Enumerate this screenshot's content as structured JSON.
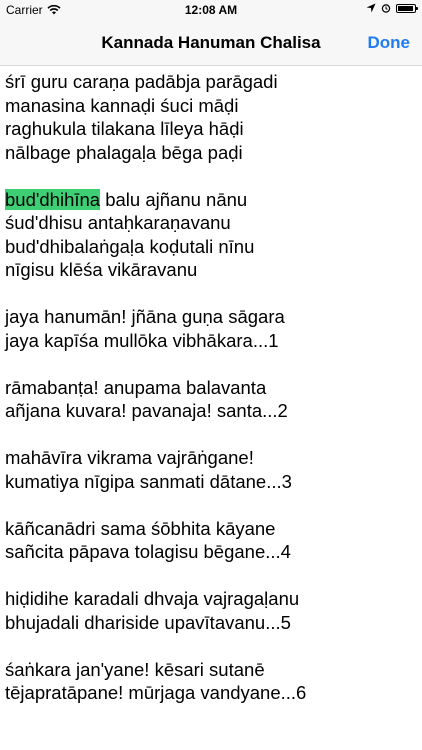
{
  "status_bar": {
    "carrier": "Carrier",
    "time": "12:08 AM",
    "battery_level": 0.95
  },
  "nav": {
    "title": "Kannada Hanuman Chalisa",
    "done_label": "Done"
  },
  "verses": [
    {
      "lines": [
        {
          "text": "śrī guru caraṇa padābja parāgadi"
        },
        {
          "text": "manasina kannaḍi śuci māḍi"
        },
        {
          "text": "raghukula tilakana līleya hāḍi"
        },
        {
          "text": "nālbage phalagaḷa bēga paḍi"
        }
      ]
    },
    {
      "lines": [
        {
          "highlight": "bud'dhihīna",
          "text": " balu ajñanu nānu"
        },
        {
          "text": "śud'dhisu antaḥkaraṇavanu"
        },
        {
          "text": "bud'dhibalaṅgaḷa koḍutali nīnu"
        },
        {
          "text": "nīgisu klēśa vikāravanu"
        }
      ]
    },
    {
      "lines": [
        {
          "text": "jaya hanumān! jñāna guṇa sāgara"
        },
        {
          "text": "jaya kapīśa mullōka vibhākara...1"
        }
      ]
    },
    {
      "lines": [
        {
          "text": "rāmabanṭa! anupama balavanta"
        },
        {
          "text": "añjana kuvara! pavanaja! santa...2"
        }
      ]
    },
    {
      "lines": [
        {
          "text": "mahāvīra vikrama vajrāṅgane!"
        },
        {
          "text": "kumatiya nīgipa sanmati dātane...3"
        }
      ]
    },
    {
      "lines": [
        {
          "text": "kāñcanādri sama śōbhita kāyane"
        },
        {
          "text": "sañcita pāpava tolagisu bēgane...4"
        }
      ]
    },
    {
      "lines": [
        {
          "text": "hiḍidihe karadali dhvaja vajragaḷanu"
        },
        {
          "text": "bhujadali dhariside upavītavanu...5"
        }
      ]
    },
    {
      "lines": [
        {
          "text": "śaṅkara jan'yane! kēsari sutanē"
        },
        {
          "text": "tējapratāpane! mūrjaga vandyane...6"
        }
      ]
    }
  ]
}
